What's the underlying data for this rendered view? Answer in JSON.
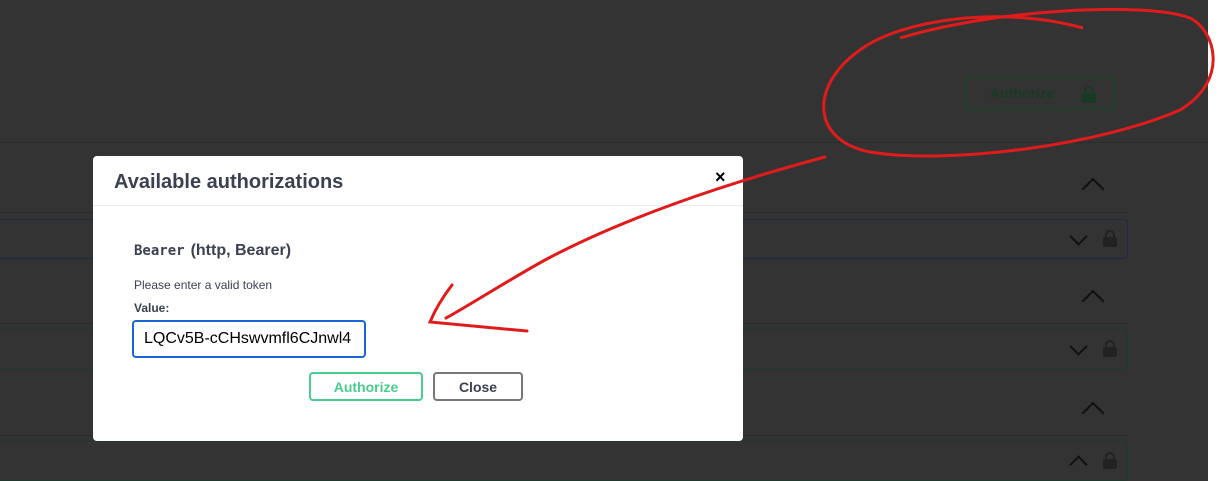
{
  "header": {
    "authorize_label": "Authorize"
  },
  "modal": {
    "title": "Available authorizations",
    "close_glyph": "×",
    "scheme_name": "Bearer",
    "scheme_type": "(http, Bearer)",
    "hint": "Please enter a valid token",
    "value_label": "Value:",
    "value": "LQCv5B-cCHswvmfl6CJnwl4",
    "authorize_label": "Authorize",
    "close_label": "Close"
  },
  "colors": {
    "accent_green": "#49cc90",
    "focus_blue": "#1a64d6",
    "annotation_red": "#e01b1b"
  }
}
